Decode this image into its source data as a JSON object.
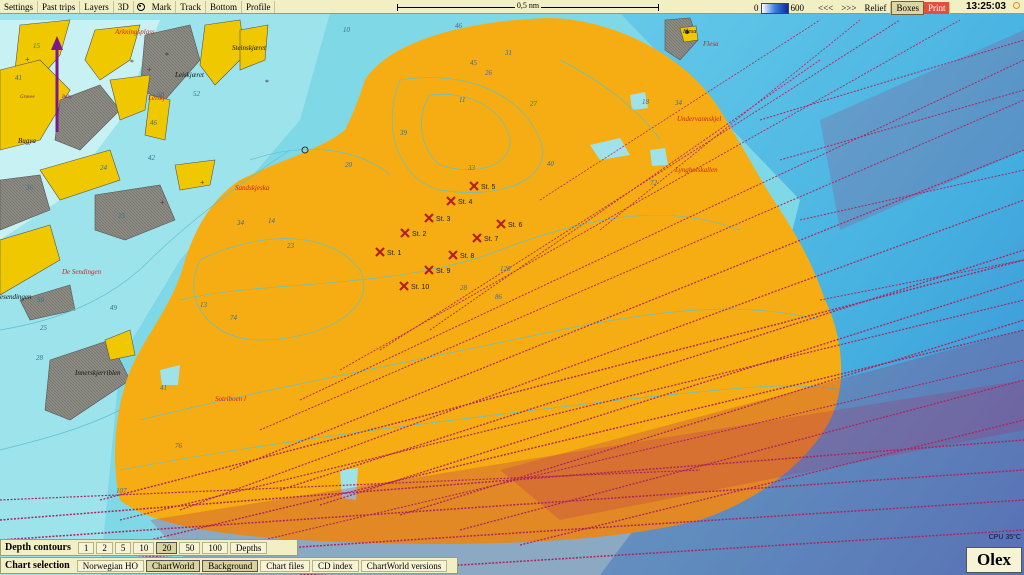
{
  "toolbar": {
    "settings": "Settings",
    "past_trips": "Past trips",
    "layers": "Layers",
    "threed": "3D",
    "mark": "Mark",
    "track": "Track",
    "bottom": "Bottom",
    "profile": "Profile",
    "scale_label": "0,5 nm",
    "depth_min": "0",
    "depth_max": "600",
    "back": "<<<",
    "forward": ">>>",
    "relief": "Relief",
    "boxes": "Boxes",
    "print": "Print",
    "time": "13:25:03"
  },
  "depth_contours": {
    "title": "Depth contours",
    "options": [
      "1",
      "2",
      "5",
      "10",
      "20",
      "50",
      "100",
      "Depths"
    ],
    "selected": "20"
  },
  "chart_selection": {
    "title": "Chart selection",
    "options": [
      "Norwegian HO",
      "ChartWorld",
      "Background",
      "Chart files",
      "CD index",
      "ChartWorld versions"
    ],
    "active": [
      "ChartWorld",
      "Background"
    ]
  },
  "cpu": "CPU 35°C",
  "brand": "Olex",
  "place_names": {
    "arkningsplass": "Arkningsplass",
    "steinskjaeret": "Steinskjæret",
    "leiskjaeret": "Leiskjæret",
    "leiskj": "Leiskj",
    "bugya": "Bugya",
    "flesa": "Flesa",
    "sandskjeska": "Sandskjeska",
    "undervannsskjel": "Undervannskjel",
    "lyngholskallen": "Lyngholskallen",
    "de_sendingen": "De Sendingen",
    "esendingen": "esendingen",
    "innerskjerriblen": "Innerskjerriblen",
    "sotriboen": "Sotriboen l",
    "gruvee": "Gruvee",
    "baby": "Baby",
    "flesa2": "Flesa"
  },
  "stations": [
    {
      "label": "St. 1"
    },
    {
      "label": "St. 2"
    },
    {
      "label": "St. 3"
    },
    {
      "label": "St. 4"
    },
    {
      "label": "St. 5"
    },
    {
      "label": "St. 6"
    },
    {
      "label": "St. 7"
    },
    {
      "label": "St. 8"
    },
    {
      "label": "St. 9"
    },
    {
      "label": "St. 10"
    }
  ],
  "soundings": [
    "10",
    "15",
    "41",
    "50",
    "46",
    "42",
    "52",
    "36",
    "25",
    "34",
    "33",
    "40",
    "27",
    "18",
    "14",
    "23",
    "24",
    "20",
    "39",
    "26",
    "31",
    "34",
    "46",
    "11",
    "45",
    "13",
    "56",
    "49",
    "76",
    "41",
    "72",
    "74",
    "128",
    "86",
    "28",
    "25",
    "28",
    "107"
  ],
  "colors": {
    "water_shallow": "#7fd8e6",
    "water_light": "#bff0f4",
    "land": "#f0c800",
    "rock": "#8c8c84",
    "survey_area": "#f5ad13",
    "tracks": "#b0245e",
    "deep_water": "#3fa8e0",
    "station_marker": "#b3201e",
    "north_arrow": "#7a1a8a"
  }
}
